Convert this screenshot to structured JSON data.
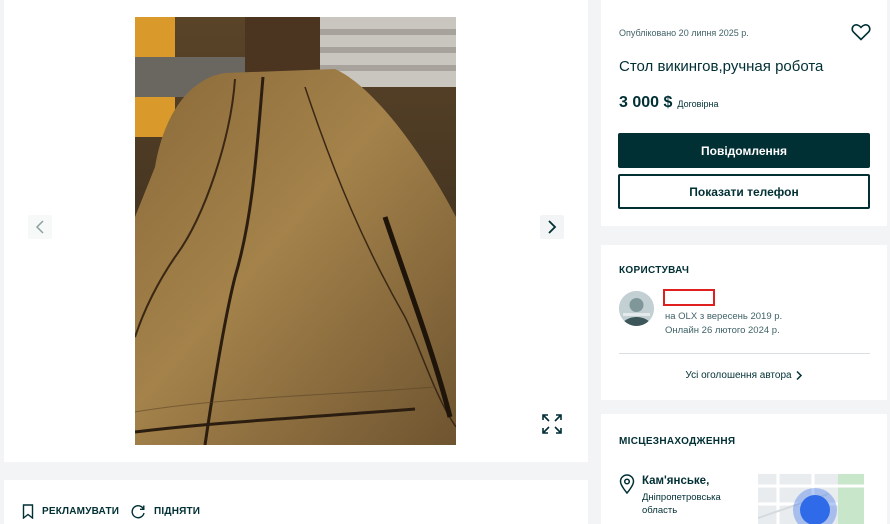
{
  "colors": {
    "brand_dark": "#002f34",
    "secondary_text": "#406367",
    "background": "#f2f4f5",
    "card": "#ffffff",
    "redaction": "#e0201e",
    "map_dot": "#2f6be8"
  },
  "gallery": {
    "prev_icon": "chevron-left-icon",
    "next_icon": "chevron-right-icon",
    "expand_icon": "expand-icon",
    "photo": "wooden-table-photo"
  },
  "actions": {
    "promote_label": "РЕКЛАМУВАТИ",
    "promote_icon": "bookmark-icon",
    "raise_label": "ПІДНЯТИ",
    "raise_icon": "refresh-icon"
  },
  "offer": {
    "published": "Опубліковано 20 липня 2025 р.",
    "title": "Стол викингов,ручная робота",
    "price": "3 000 $",
    "negotiable": "Договірна",
    "message_button": "Повідомлення",
    "phone_button": "Показати телефон",
    "favorite_icon": "heart-icon"
  },
  "user": {
    "section_title": "КОРИСТУВАЧ",
    "member_since": "на OLX з вересень 2019 р.",
    "last_online": "Онлайн 26 лютого 2024 р.",
    "all_ads": "Усі оголошення автора",
    "avatar_icon": "avatar-icon"
  },
  "location": {
    "section_title": "МІСЦЕЗНАХОДЖЕННЯ",
    "city": "Кам'янське,",
    "region": "Дніпропетровська область",
    "pin_icon": "location-pin-icon"
  }
}
